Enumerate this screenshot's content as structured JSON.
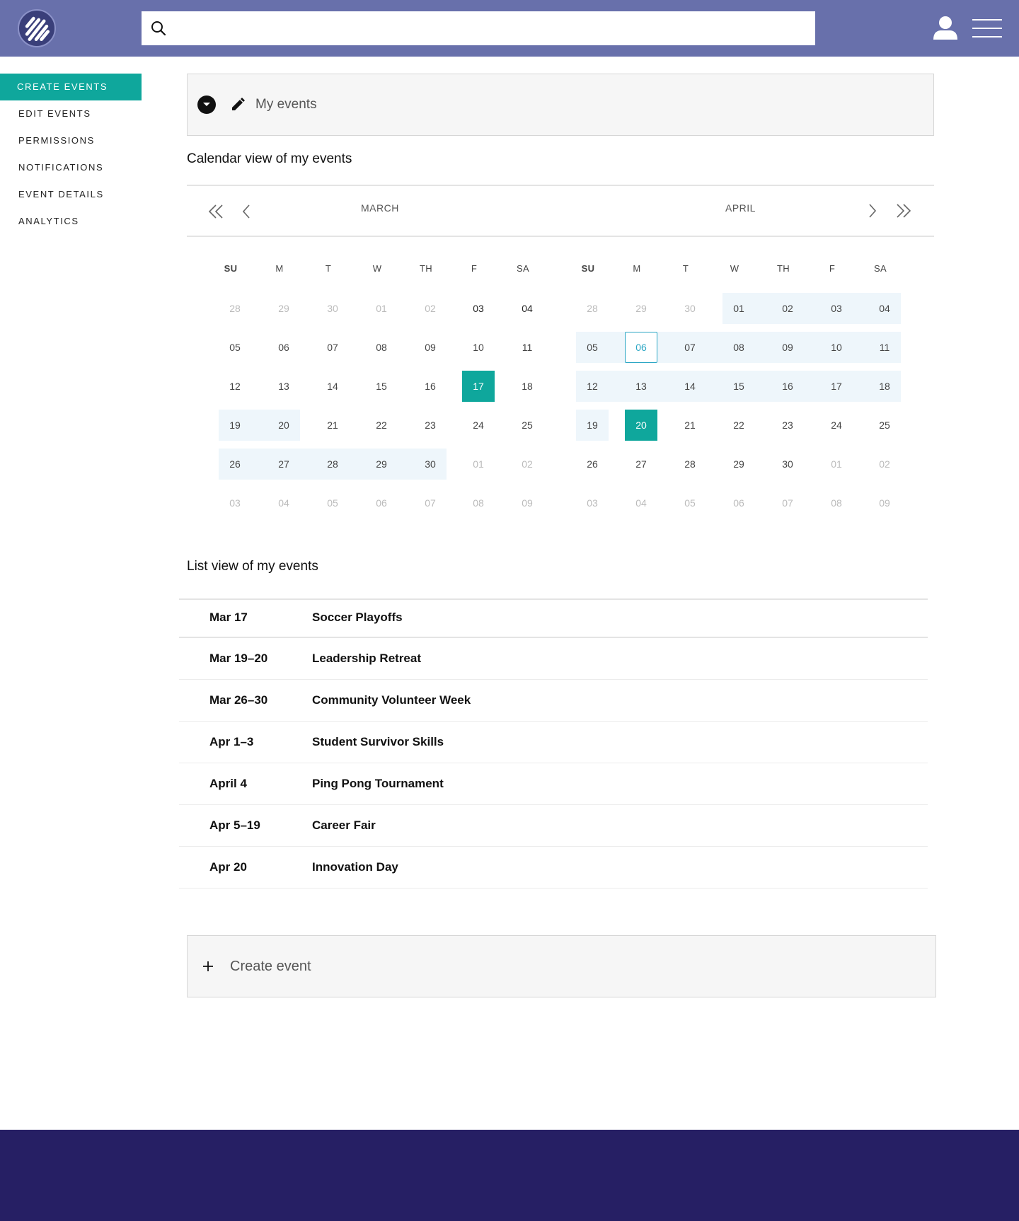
{
  "header": {
    "search_placeholder": "",
    "colors": {
      "header": "#6870ab",
      "accent": "#0fa79c",
      "footer": "#261f64"
    },
    "icons": {
      "logo": "striped-circle-logo",
      "search": "search-icon",
      "user": "user-icon",
      "menu": "hamburger-menu-icon"
    }
  },
  "sidebar": {
    "items": [
      {
        "label": "CREATE EVENTS",
        "active": true
      },
      {
        "label": "EDIT EVENTS"
      },
      {
        "label": "PERMISSIONS"
      },
      {
        "label": "NOTIFICATIONS"
      },
      {
        "label": "EVENT DETAILS"
      },
      {
        "label": "ANALYTICS"
      }
    ]
  },
  "my_events": {
    "title": "My events",
    "icons": [
      "chevron-down-icon",
      "pencil-icon"
    ]
  },
  "calendar": {
    "title": "Calendar view of my events",
    "weekdays": [
      "SU",
      "M",
      "T",
      "W",
      "TH",
      "F",
      "SA"
    ],
    "months": [
      {
        "name": "MARCH",
        "weeks": [
          [
            "28",
            "29",
            "30",
            "01",
            "02",
            "03",
            "04"
          ],
          [
            "05",
            "06",
            "07",
            "08",
            "09",
            "10",
            "11"
          ],
          [
            "12",
            "13",
            "14",
            "15",
            "16",
            "17",
            "18"
          ],
          [
            "19",
            "20",
            "21",
            "22",
            "23",
            "24",
            "25"
          ],
          [
            "26",
            "27",
            "28",
            "29",
            "30",
            "01",
            "02"
          ],
          [
            "03",
            "04",
            "05",
            "06",
            "07",
            "08",
            "09"
          ]
        ]
      },
      {
        "name": "APRIL",
        "weeks": [
          [
            "28",
            "29",
            "30",
            "01",
            "02",
            "03",
            "04"
          ],
          [
            "05",
            "06",
            "07",
            "08",
            "09",
            "10",
            "11"
          ],
          [
            "12",
            "13",
            "14",
            "15",
            "16",
            "17",
            "18"
          ],
          [
            "19",
            "20",
            "21",
            "22",
            "23",
            "24",
            "25"
          ],
          [
            "26",
            "27",
            "28",
            "29",
            "30",
            "01",
            "02"
          ],
          [
            "03",
            "04",
            "05",
            "06",
            "07",
            "08",
            "09"
          ]
        ]
      }
    ]
  },
  "list": {
    "title": "List view of my events",
    "events": [
      {
        "date": "Mar 17",
        "name": "Soccer Playoffs"
      },
      {
        "date": "Mar 19–20",
        "name": "Leadership Retreat"
      },
      {
        "date": "Mar 26–30",
        "name": "Community Volunteer Week"
      },
      {
        "date": "Apr 1–3",
        "name": "Student Survivor Skills"
      },
      {
        "date": "April 4",
        "name": "Ping Pong Tournament"
      },
      {
        "date": "Apr 5–19",
        "name": "Career Fair"
      },
      {
        "date": "Apr 20",
        "name": "Innovation Day"
      }
    ]
  },
  "create": {
    "label": "Create event",
    "icon": "plus-icon"
  }
}
